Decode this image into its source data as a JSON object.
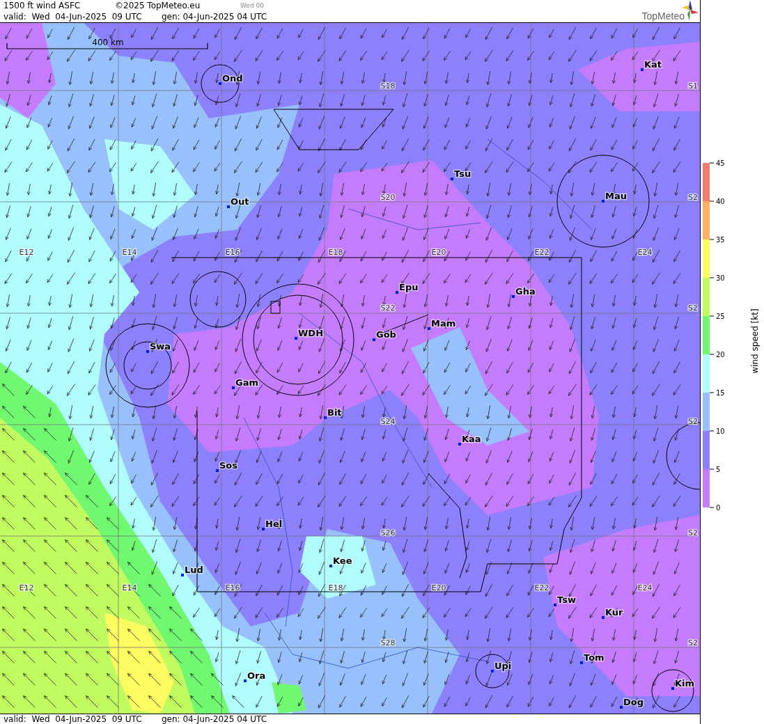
{
  "header": {
    "title": "1500 ft wind ASFC",
    "copyright": "©2025 TopMeteo.eu",
    "run_label": "Wed 00",
    "valid": "valid:  Wed  04-Jun-2025  09 UTC",
    "gen": "gen: 04-Jun-2025 04 UTC",
    "logo_text": "TopMeteo"
  },
  "map": {
    "scale_label": "400 km",
    "longitude_labels": [
      "E12",
      "E14",
      "E16",
      "E18",
      "E20",
      "E22",
      "E24"
    ],
    "longitude_labels_lower": [
      "E12",
      "E14",
      "E16",
      "E18",
      "E20",
      "E22",
      "E24"
    ],
    "latitude_labels": [
      "S18",
      "S20",
      "S22",
      "S24",
      "S26",
      "S28"
    ],
    "latitude_labels_edge": [
      "S1",
      "S2",
      "S2",
      "S2",
      "S2",
      "S2"
    ],
    "places": [
      "Ond",
      "Kat",
      "Tsu",
      "Out",
      "Mau",
      "Epu",
      "Gha",
      "Mam",
      "WDH",
      "Gob",
      "Swa",
      "Gam",
      "Bit",
      "Kaa",
      "Sos",
      "Hel",
      "Kee",
      "Lud",
      "Tsw",
      "Kur",
      "Tom",
      "Upi",
      "Ora",
      "Kim",
      "Dog"
    ]
  },
  "legend": {
    "title": "wind speed [kt]",
    "ticks": [
      "45",
      "40",
      "35",
      "30",
      "25",
      "20",
      "15",
      "10",
      "5",
      "0"
    ],
    "bands": [
      {
        "color": "#f47c6c"
      },
      {
        "color": "#fcb060"
      },
      {
        "color": "#fcfc60"
      },
      {
        "color": "#c0fc60"
      },
      {
        "color": "#70f870"
      },
      {
        "color": "#b0fcfc"
      },
      {
        "color": "#98c0fc"
      },
      {
        "color": "#8c80fc"
      },
      {
        "color": "#c47cfc"
      }
    ]
  },
  "footer": {
    "valid": "valid:  Wed  04-Jun-2025  09 UTC",
    "gen": "gen: 04-Jun-2025 04 UTC"
  }
}
